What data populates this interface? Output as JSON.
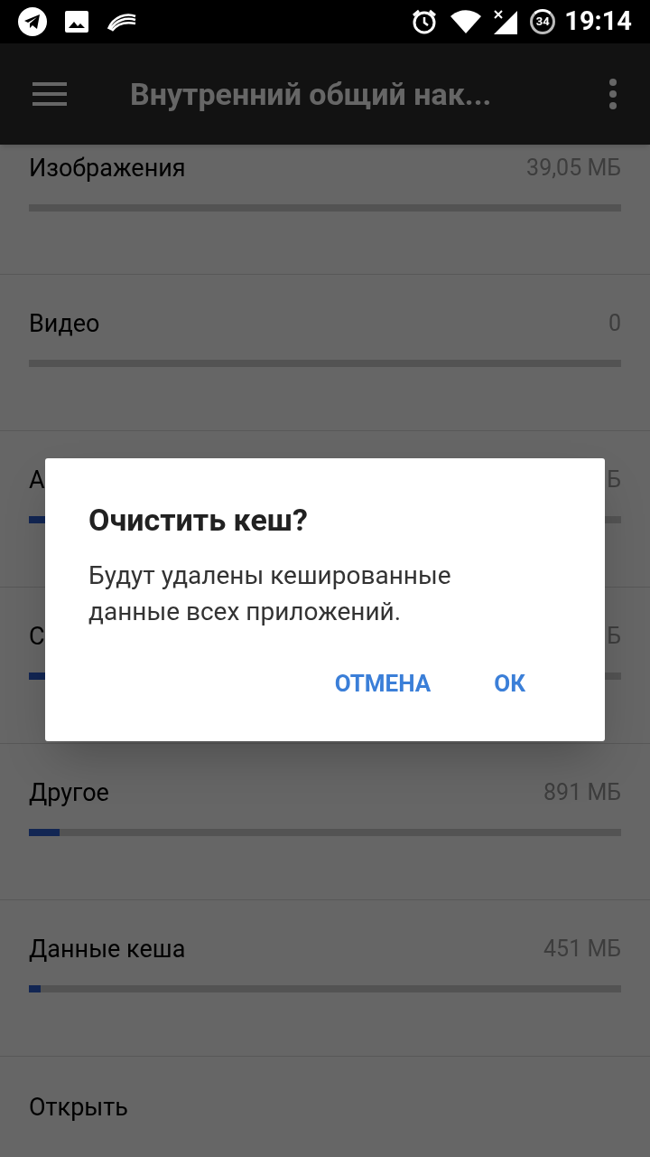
{
  "status_bar": {
    "battery": "34",
    "time": "19:14"
  },
  "toolbar": {
    "title": "Внутренний общий нак..."
  },
  "items": [
    {
      "label": "Изображения",
      "value": "39,05 МБ"
    },
    {
      "label": "Видео",
      "value": "0"
    },
    {
      "label": "А",
      "value": "Б",
      "level": 0.03
    },
    {
      "label": "С",
      "value": "Б",
      "level": 0.03
    },
    {
      "label": "Другое",
      "value": "891 МБ",
      "level": 0.052
    },
    {
      "label": "Данные кеша",
      "value": "451 МБ",
      "level": 0.02
    }
  ],
  "footer_item": {
    "label": "Открыть"
  },
  "dialog": {
    "title": "Очистить кеш?",
    "message": "Будут удалены кешированные данные всех приложений.",
    "buttons": [
      "ОТМЕНА",
      "ОК"
    ]
  }
}
